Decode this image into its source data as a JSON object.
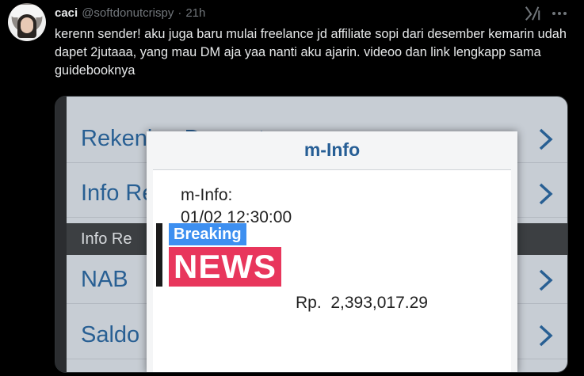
{
  "tweet": {
    "display_name": "caci",
    "handle": "@softdonutcrispy",
    "separator": "·",
    "time": "21h",
    "text": "kerenn sender! aku juga baru mulai freelance jd affiliate sopi dari desember kemarin udah dapet 2jutaaa, yang mau DM aja yaa nanti aku ajarin. videoo dan link lengkapp sama guidebooknya",
    "icons": {
      "grok": "grok-icon",
      "more": "more-icon"
    }
  },
  "media": {
    "menu_items": [
      {
        "label": "Rekening Dompet"
      },
      {
        "label": "Info Rekening"
      },
      {
        "label": "NAB"
      },
      {
        "label": "Saldo"
      }
    ],
    "section_label": "Info Re",
    "popup": {
      "title": "m-Info",
      "line1": "m-Info:",
      "line2": "01/02 12:30:00",
      "amount": "Rp.  2,393,017.29"
    },
    "badge": {
      "top": "Breaking",
      "bottom": "NEWS"
    }
  },
  "colors": {
    "accent": "#285f93",
    "breaking": "#3d8ff0",
    "news": "#e8365c"
  }
}
